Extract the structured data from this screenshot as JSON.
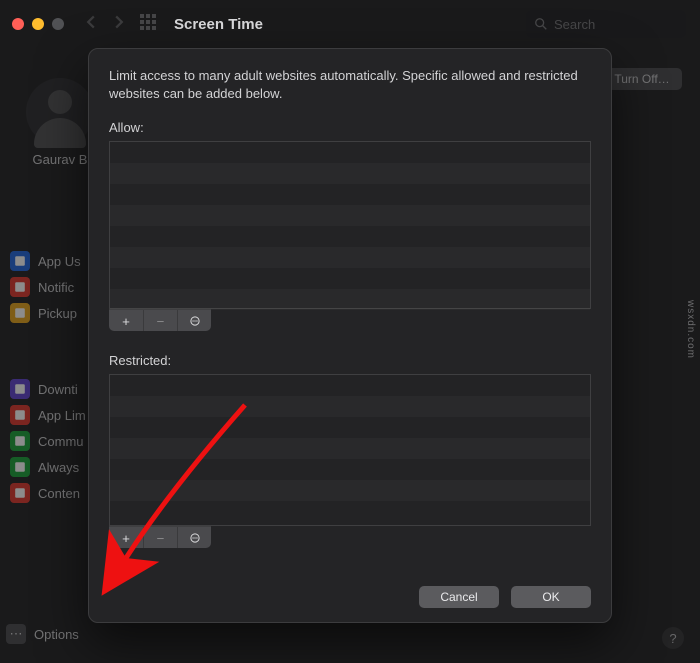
{
  "toolbar": {
    "title": "Screen Time",
    "search_placeholder": "Search"
  },
  "background": {
    "turn_off_label": "Turn Off…",
    "user_name": "Gaurav B",
    "group1": [
      {
        "label": "App Us",
        "icon": "bars-icon",
        "color": "#2d6fe0"
      },
      {
        "label": "Notific",
        "icon": "bell-icon",
        "color": "#e0443a"
      },
      {
        "label": "Pickup",
        "icon": "hand-icon",
        "color": "#e7a92a"
      }
    ],
    "group2": [
      {
        "label": "Downti",
        "icon": "moon-icon",
        "color": "#6a4fd1"
      },
      {
        "label": "App Lim",
        "icon": "hourglass-icon",
        "color": "#e0443a"
      },
      {
        "label": "Commu",
        "icon": "chat-icon",
        "color": "#28a745"
      },
      {
        "label": "Always",
        "icon": "check-icon",
        "color": "#28a745"
      },
      {
        "label": "Conten",
        "icon": "no-icon",
        "color": "#e0443a"
      }
    ],
    "options_label": "Options"
  },
  "sheet": {
    "description": "Limit access to many adult websites automatically. Specific allowed and restricted websites can be added below.",
    "allow_label": "Allow:",
    "restricted_label": "Restricted:",
    "allow_items": [],
    "restricted_items": [],
    "cancel_label": "Cancel",
    "ok_label": "OK"
  },
  "icons": {
    "plus": "+",
    "minus": "−",
    "more": "⋯",
    "help": "?"
  },
  "watermark": "wsxdn.com"
}
